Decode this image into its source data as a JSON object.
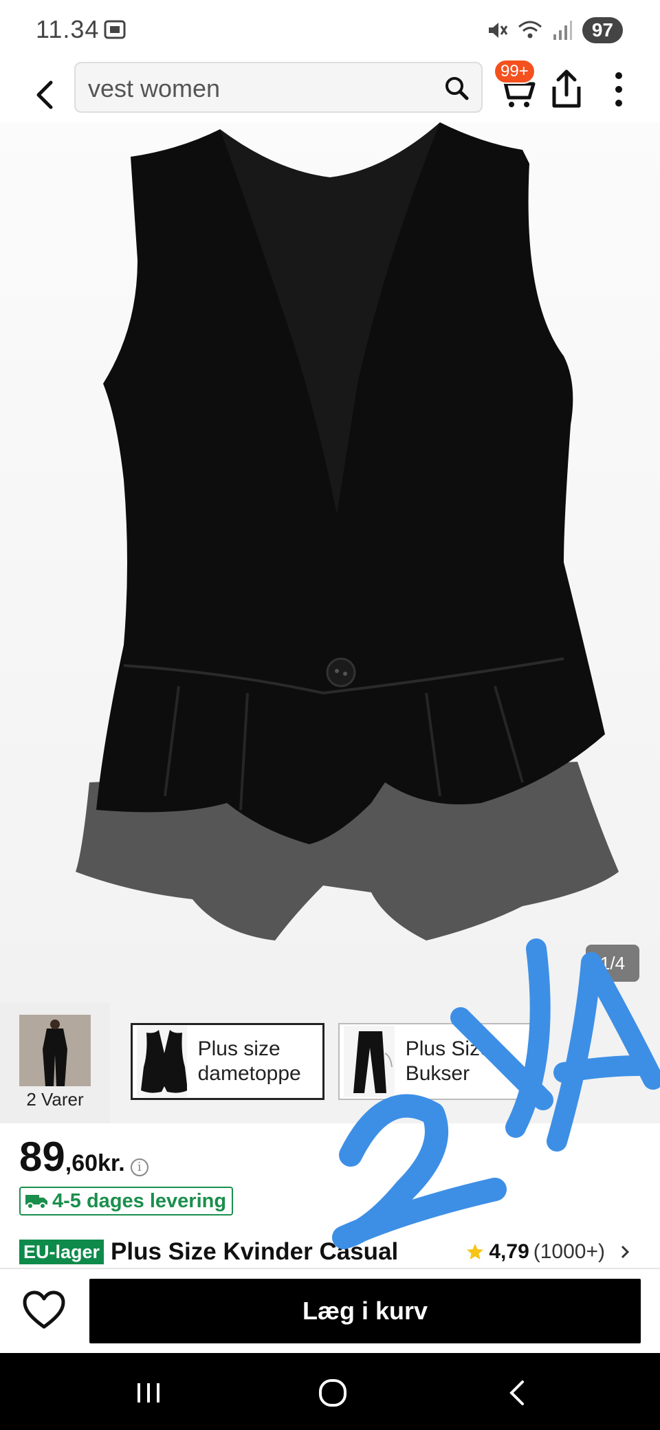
{
  "status_bar": {
    "time": "11.34",
    "battery": "97",
    "icons": [
      "screenshot-icon",
      "mute-icon",
      "wifi-icon",
      "signal-icon"
    ]
  },
  "header": {
    "search_text": "vest women",
    "cart_badge": "99+",
    "icons": [
      "back-icon",
      "search-icon",
      "cart-icon",
      "share-icon",
      "more-icon"
    ]
  },
  "gallery": {
    "counter": "1/4"
  },
  "related": {
    "bundle_label": "2 Varer",
    "items": [
      {
        "label": "Plus size dametoppe"
      },
      {
        "label": "Plus Size Bukser"
      }
    ]
  },
  "product": {
    "price_integer": "89",
    "price_decimal": ",60kr.",
    "delivery": "4-5 dages levering",
    "warehouse_tag": "EU-lager",
    "title": "Plus Size Kvinder Casual",
    "rating": "4,79",
    "rating_count": "(1000+)"
  },
  "actions": {
    "add_to_cart": "Læg i kurv"
  },
  "annotation": {
    "handwritten_text": "2X"
  },
  "colors": {
    "accent_green": "#0e8a4a",
    "badge_orange": "#f4511e",
    "primary_button": "#000000",
    "annotation_blue": "#3d8fe6"
  }
}
